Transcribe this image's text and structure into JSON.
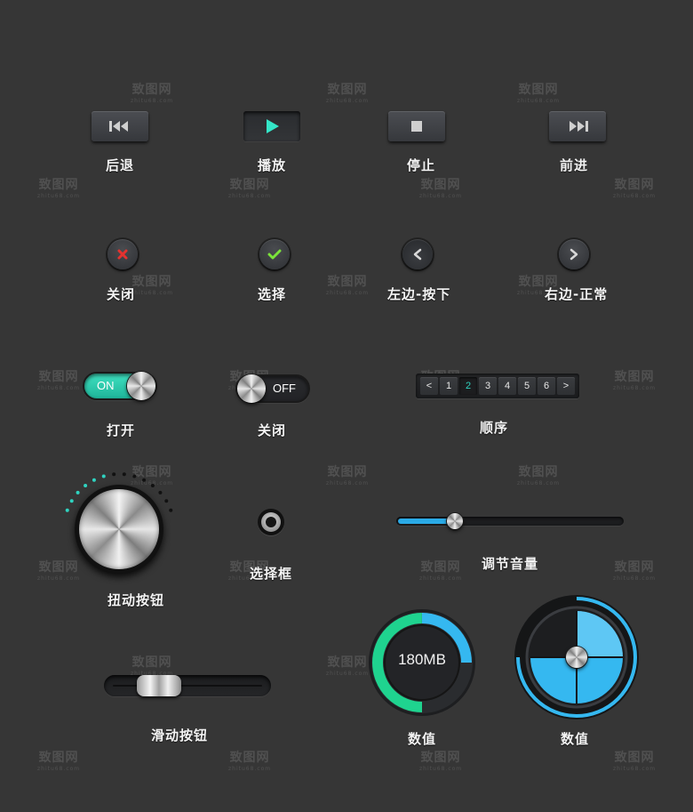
{
  "watermark": {
    "text": "致图网",
    "sub": "zhitu68.com"
  },
  "media": {
    "rewind_label": "后退",
    "play_label": "播放",
    "stop_label": "停止",
    "forward_label": "前进"
  },
  "round_buttons": {
    "close_label": "关闭",
    "select_label": "选择",
    "left_label": "左边-按下",
    "right_label": "右边-正常"
  },
  "toggles": {
    "on_text": "ON",
    "off_text": "OFF",
    "open_label": "打开",
    "close_label": "关闭"
  },
  "pager": {
    "prev": "<",
    "next": ">",
    "pages": [
      "1",
      "2",
      "3",
      "4",
      "5",
      "6"
    ],
    "current": "2",
    "label": "顺序"
  },
  "knob": {
    "label": "扭动按钮"
  },
  "radio": {
    "label": "选择框"
  },
  "volume": {
    "label": "调节音量",
    "level": 0.25,
    "accent": "#2aaae6"
  },
  "slide_button": {
    "label": "滑动按钮"
  },
  "gauge_mb": {
    "value_text": "180MB",
    "label": "数值",
    "fill": 0.75,
    "accent": "#1fd38f"
  },
  "gauge_pie": {
    "label": "数值",
    "fill": 0.75,
    "accent": "#35b8f0"
  },
  "colors": {
    "teal": "#2fd3c0",
    "background": "#363636"
  }
}
